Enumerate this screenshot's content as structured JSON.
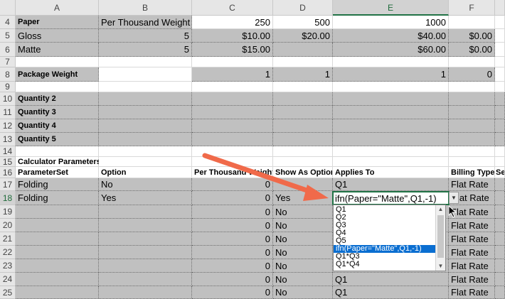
{
  "columns": [
    "A",
    "B",
    "C",
    "D",
    "E",
    "F"
  ],
  "selected_column": "E",
  "selected_row": "18",
  "rows": [
    "4",
    "5",
    "6",
    "7",
    "8",
    "9",
    "10",
    "11",
    "12",
    "13",
    "14",
    "15",
    "16",
    "17",
    "18",
    "19",
    "20",
    "21",
    "22",
    "23",
    "24",
    "25"
  ],
  "cells": {
    "r4": {
      "a": "Paper",
      "b": "Per Thousand Weight",
      "c": "250",
      "d": "500",
      "e": "1000",
      "f": ""
    },
    "r5": {
      "a": "Gloss",
      "b": "5",
      "c": "$10.00",
      "d": "$20.00",
      "e": "$40.00",
      "f": "$0.00"
    },
    "r6": {
      "a": "Matte",
      "b": "5",
      "c": "$15.00",
      "d": "",
      "e": "$60.00",
      "f": "$0.00"
    },
    "r8": {
      "a": "Package Weight",
      "c": "1",
      "d": "1",
      "e": "1",
      "f": "0"
    },
    "r10": {
      "a": "Quantity 2"
    },
    "r11": {
      "a": "Quantity 3"
    },
    "r12": {
      "a": "Quantity 4"
    },
    "r13": {
      "a": "Quantity 5"
    },
    "r15": {
      "a": "Calculator Parameters"
    },
    "r16": {
      "a": "ParameterSet",
      "b": "Option",
      "c": "Per Thousand Weight",
      "d": "Show As Option",
      "e": "Applies To",
      "f": "Billing Type",
      "g": "Se"
    },
    "r17": {
      "a": "Folding",
      "b": "No",
      "c": "0",
      "d": "",
      "e": "Q1",
      "f": "Flat Rate"
    },
    "r18": {
      "a": "Folding",
      "b": "Yes",
      "c": "0",
      "d": "Yes",
      "e": "ifn(Paper=\"Matte\",Q1,-1)",
      "f": "Flat Rate"
    },
    "r19": {
      "c": "0",
      "d": "No",
      "f": "Flat Rate"
    },
    "r20": {
      "c": "0",
      "d": "No",
      "f": "Flat Rate"
    },
    "r21": {
      "c": "0",
      "d": "No",
      "f": "Flat Rate"
    },
    "r22": {
      "c": "0",
      "d": "No",
      "f": "Flat Rate"
    },
    "r23": {
      "c": "0",
      "d": "No",
      "f": "Flat Rate"
    },
    "r24": {
      "c": "0",
      "d": "No",
      "e": "Q1",
      "f": "Flat Rate"
    },
    "r25": {
      "c": "0",
      "d": "No",
      "e": "Q1",
      "f": "Flat Rate"
    }
  },
  "dropdown": {
    "options": [
      "Q1",
      "Q2",
      "Q3",
      "Q4",
      "Q5",
      "ifn(Paper=\"Matte\",Q1,-1)",
      "Q1*Q3",
      "Q1*Q4"
    ],
    "highlighted": "ifn(Paper=\"Matte\",Q1,-1)"
  },
  "colors": {
    "accent": "#217346",
    "arrow": "#f06a4a",
    "highlight": "#0a6ed1",
    "cell_fill": "#c0c0c0"
  }
}
